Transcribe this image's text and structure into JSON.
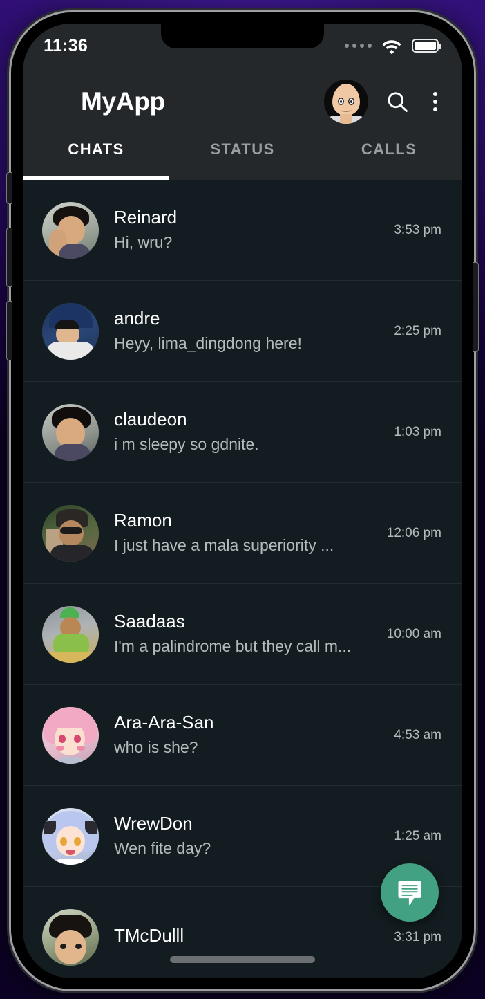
{
  "status_bar": {
    "time": "11:36",
    "signal_icon": "signal-dots-icon",
    "wifi_icon": "wifi-icon",
    "battery_icon": "battery-full-icon"
  },
  "app_bar": {
    "title": "MyApp",
    "profile_avatar": "bald-anime-avatar",
    "search_icon": "search-icon",
    "menu_icon": "kebab-menu-icon"
  },
  "tabs": [
    {
      "label": "CHATS",
      "active": true
    },
    {
      "label": "STATUS",
      "active": false
    },
    {
      "label": "CALLS",
      "active": false
    }
  ],
  "chats": [
    {
      "name": "Reinard",
      "message": "Hi, wru?",
      "time": "3:53 pm"
    },
    {
      "name": "andre",
      "message": "Heyy, lima_dingdong here!",
      "time": "2:25 pm"
    },
    {
      "name": "claudeon",
      "message": "i m sleepy so gdnite.",
      "time": "1:03 pm"
    },
    {
      "name": "Ramon",
      "message": "I just have a mala superiority ...",
      "time": "12:06 pm"
    },
    {
      "name": "Saadaas",
      "message": "I'm a palindrome but they call m...",
      "time": "10:00 am"
    },
    {
      "name": "Ara-Ara-San",
      "message": "who is she?",
      "time": "4:53 am"
    },
    {
      "name": "WrewDon",
      "message": "Wen fite day?",
      "time": "1:25 am"
    },
    {
      "name": "TMcDulll",
      "message": "",
      "time": "3:31 pm"
    }
  ],
  "fab": {
    "icon": "new-chat-message-icon",
    "color": "#42a183"
  },
  "colors": {
    "app_bar_bg": "#24282b",
    "list_bg": "#131c20",
    "accent": "#42a183",
    "active_tab": "#ffffff",
    "inactive_tab": "#9a9ea2",
    "secondary_text": "#b4bbbf"
  }
}
